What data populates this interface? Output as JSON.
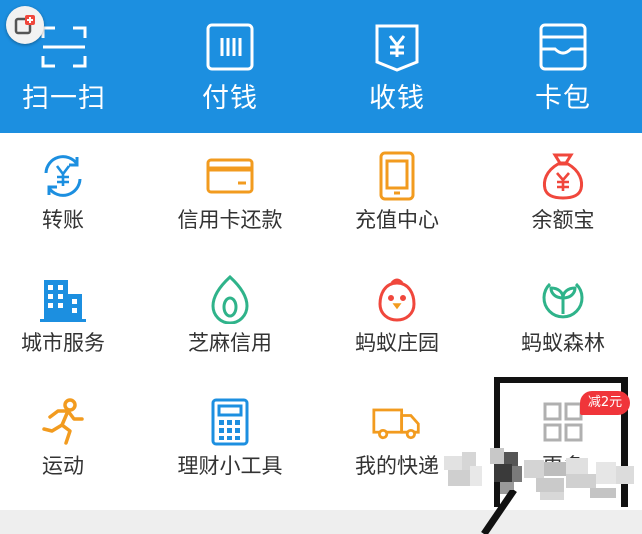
{
  "topbar": {
    "bg": "#1c8fe0",
    "items": [
      {
        "label": "扫一扫",
        "icon": "scan-icon"
      },
      {
        "label": "付钱",
        "icon": "pay-barcode-icon"
      },
      {
        "label": "收钱",
        "icon": "receive-money-icon"
      },
      {
        "label": "卡包",
        "icon": "card-wallet-icon"
      }
    ]
  },
  "grid": {
    "rows": [
      [
        {
          "label": "转账",
          "icon": "transfer-icon",
          "color": "#1c8fe0"
        },
        {
          "label": "信用卡还款",
          "icon": "credit-card-icon",
          "color": "#f29b1f"
        },
        {
          "label": "充值中心",
          "icon": "phone-topup-icon",
          "color": "#f29b1f"
        },
        {
          "label": "余额宝",
          "icon": "money-bag-icon",
          "color": "#f0473c"
        }
      ],
      [
        {
          "label": "城市服务",
          "icon": "city-building-icon",
          "color": "#1c8fe0"
        },
        {
          "label": "芝麻信用",
          "icon": "sesame-credit-icon",
          "color": "#2fb38a"
        },
        {
          "label": "蚂蚁庄园",
          "icon": "chick-icon",
          "color": "#f0473c"
        },
        {
          "label": "蚂蚁森林",
          "icon": "forest-sprout-icon",
          "color": "#2fb38a"
        }
      ],
      [
        {
          "label": "运动",
          "icon": "running-icon",
          "color": "#f29b1f"
        },
        {
          "label": "理财小工具",
          "icon": "calculator-icon",
          "color": "#1c8fe0"
        },
        {
          "label": "我的快递",
          "icon": "delivery-truck-icon",
          "color": "#f29b1f"
        },
        {
          "label": "更多",
          "icon": "more-grid-icon",
          "color": "#bbbbbb"
        }
      ]
    ]
  },
  "promo": {
    "label": "减2元",
    "color": "#f0353a"
  }
}
